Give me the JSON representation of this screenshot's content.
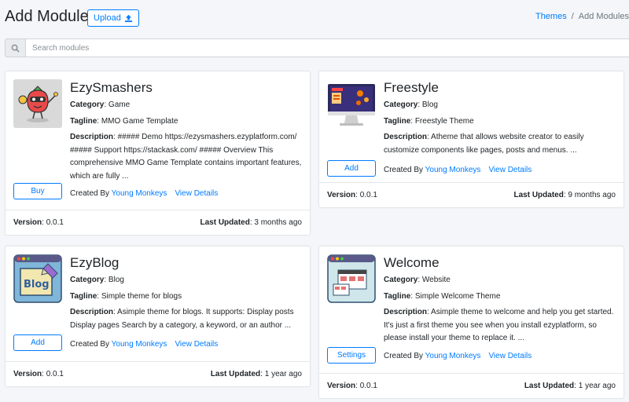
{
  "header": {
    "title": "Add Modules",
    "upload_label": "Upload",
    "breadcrumb": {
      "link": "Themes",
      "separator": "/",
      "current": "Add Modules"
    }
  },
  "search": {
    "placeholder": "Search modules",
    "value": ""
  },
  "labels": {
    "category": "Category",
    "tagline": "Tagline",
    "description": "Description",
    "created_by": "Created By",
    "view_details": "View Details",
    "version": "Version",
    "last_updated": "Last Updated"
  },
  "modules": [
    {
      "name": "EzySmashers",
      "category": "Game",
      "tagline": "MMO Game Template",
      "description": "##### Demo https://ezysmashers.ezyplatform.com/ ##### Support https://stackask.com/ ##### Overview This comprehensive MMO Game Template contains important features, which are fully ...",
      "action": "Buy",
      "author": "Young Monkeys",
      "version": "0.0.1",
      "last_updated": "3 months ago"
    },
    {
      "name": "Freestyle",
      "category": "Blog",
      "tagline": "Freestyle Theme",
      "description": "Atheme that allows website creator to easily customize components like pages, posts and menus. ...",
      "action": "Add",
      "author": "Young Monkeys",
      "version": "0.0.1",
      "last_updated": "9 months ago"
    },
    {
      "name": "EzyBlog",
      "category": "Blog",
      "tagline": "Simple theme for blogs",
      "description": "Asimple theme for blogs. It supports: Display posts Display pages Search by a category, a keyword, or an author ...",
      "action": "Add",
      "author": "Young Monkeys",
      "version": "0.0.1",
      "last_updated": "1 year ago",
      "thumb_text": "Blog"
    },
    {
      "name": "Welcome",
      "category": "Website",
      "tagline": "Simple Welcome Theme",
      "description": "Asimple theme to welcome and help you get started. It's just a first theme you see when you install ezyplatform, so please install your theme to replace it. ...",
      "action": "Settings",
      "author": "Young Monkeys",
      "version": "0.0.1",
      "last_updated": "1 year ago"
    }
  ],
  "colors": {
    "accent": "#007bff",
    "background": "#f4f6f9",
    "border": "#e3e6ea"
  }
}
